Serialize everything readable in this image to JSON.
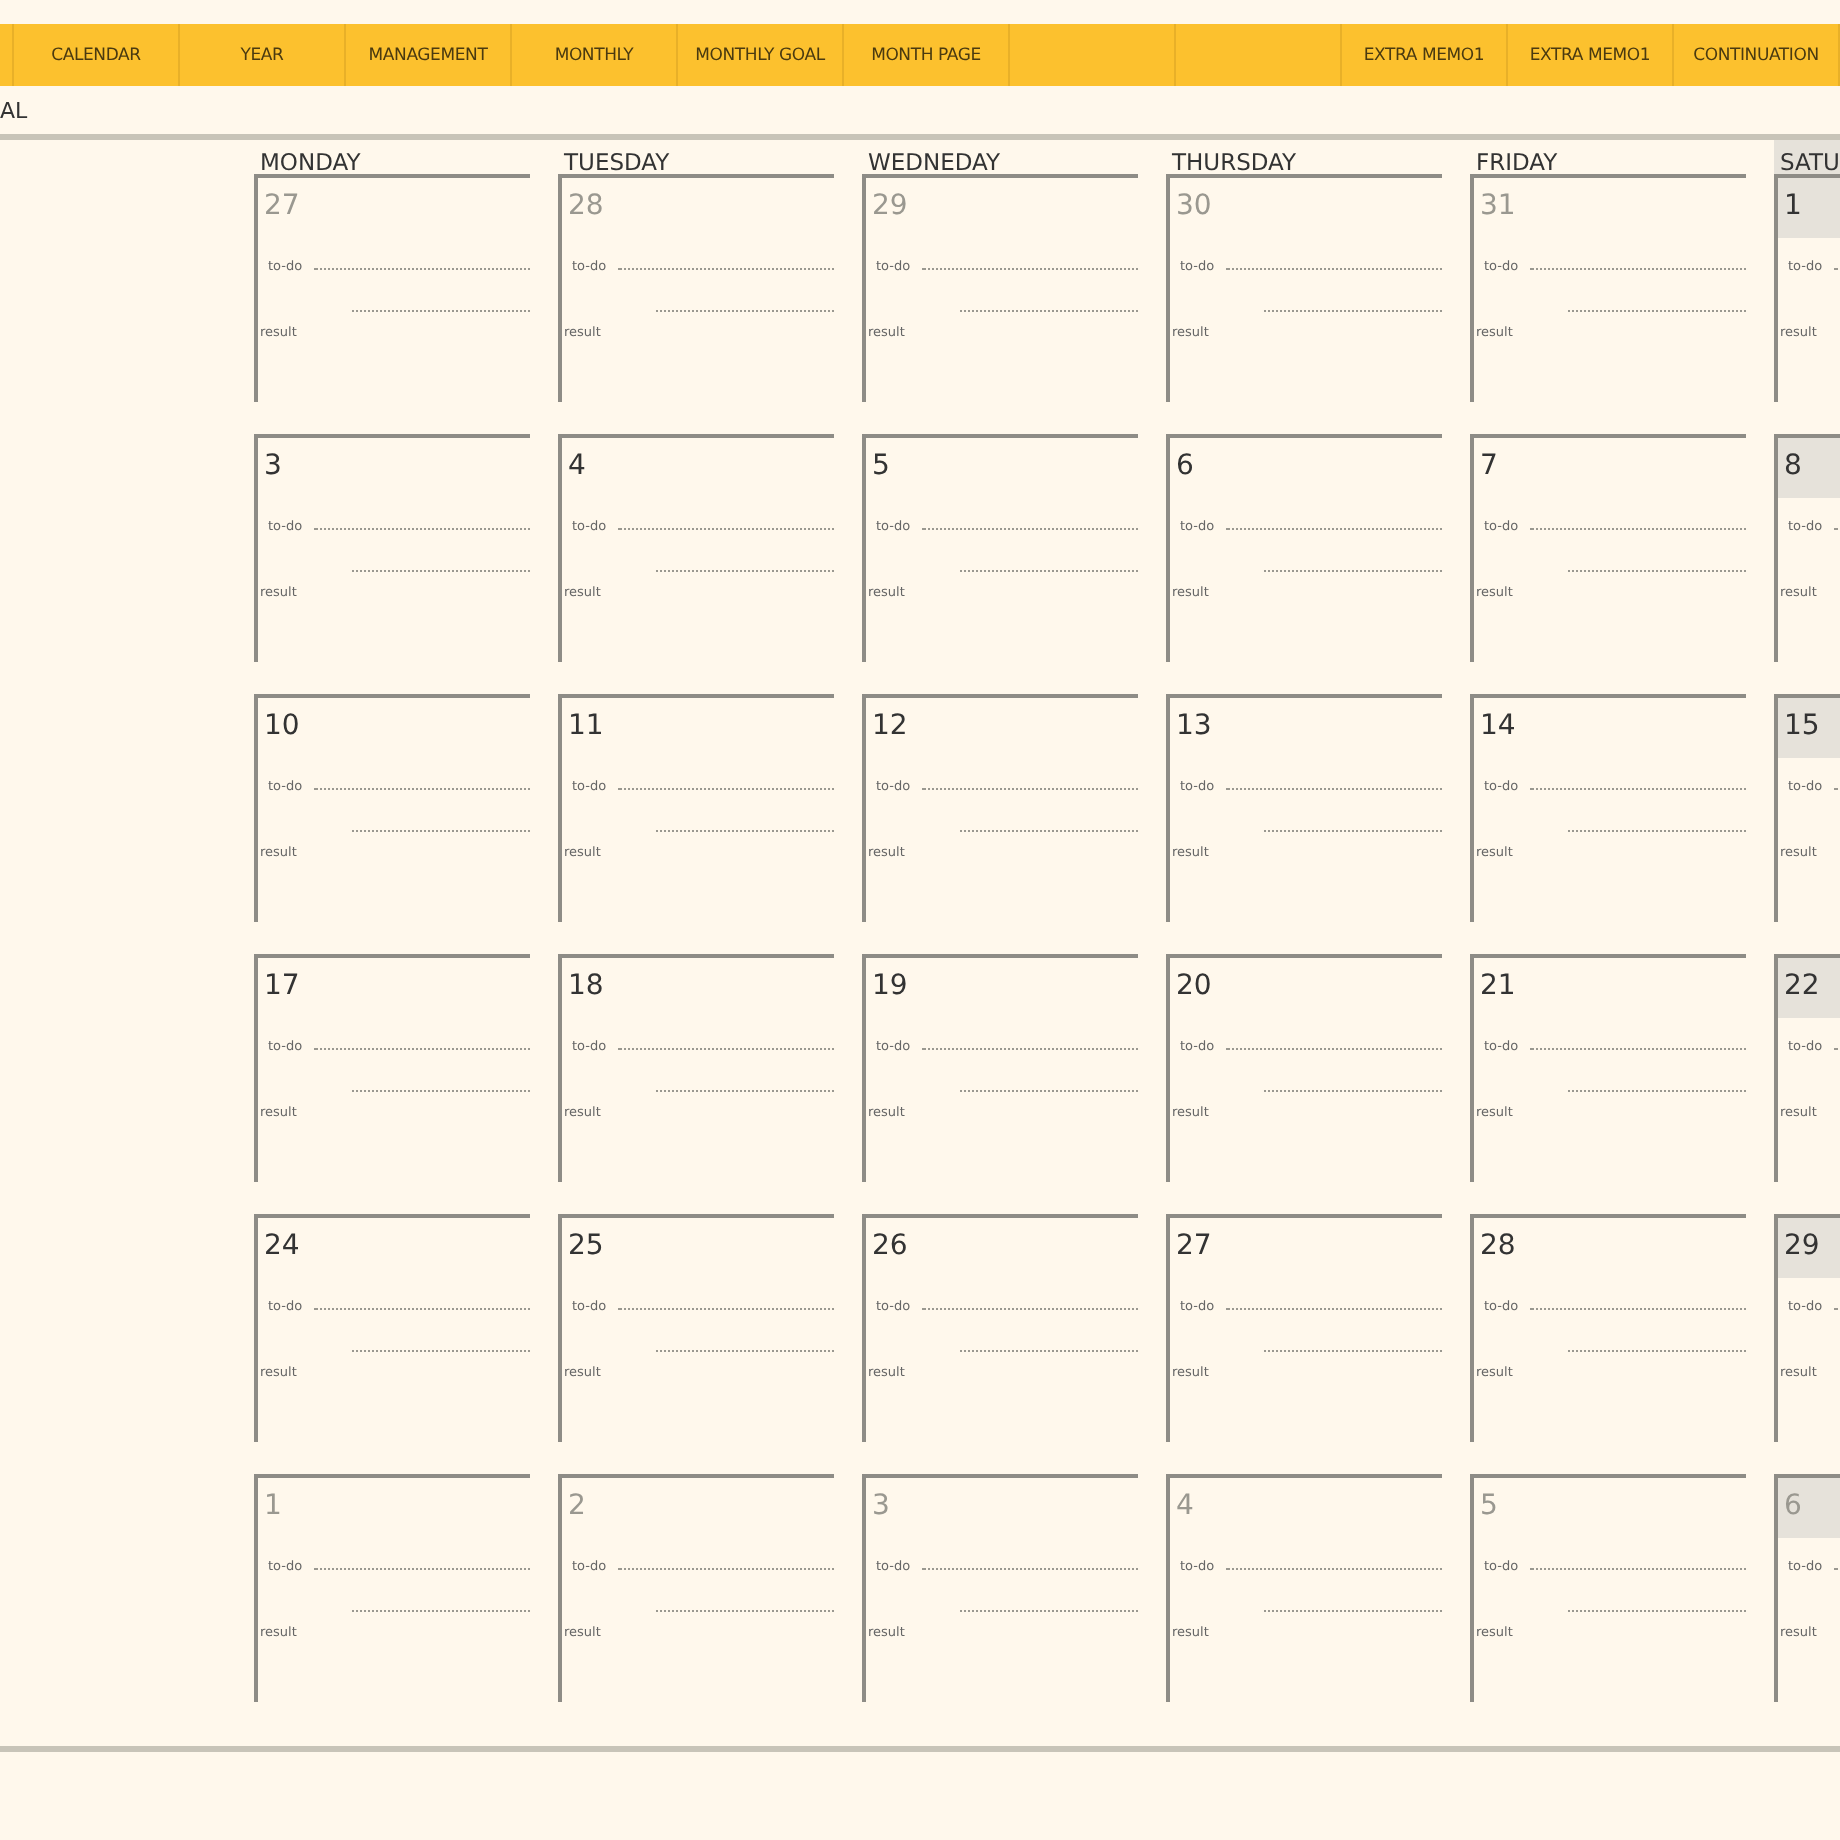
{
  "nav": [
    {
      "kind": "blank"
    },
    {
      "kind": "tab",
      "label": "CALENDAR"
    },
    {
      "kind": "tab",
      "label": "YEAR"
    },
    {
      "kind": "tab",
      "label": "MANAGEMENT"
    },
    {
      "kind": "tab",
      "label": "MONTHLY"
    },
    {
      "kind": "tab",
      "label": "MONTHLY GOAL"
    },
    {
      "kind": "tab",
      "label": "MONTH PAGE"
    },
    {
      "kind": "blank"
    },
    {
      "kind": "blank"
    },
    {
      "kind": "tab",
      "label": "EXTRA MEMO1"
    },
    {
      "kind": "tab",
      "label": "EXTRA MEMO1"
    },
    {
      "kind": "tab",
      "label": "CONTINUATION"
    }
  ],
  "sheet_title": "AL",
  "columns": [
    {
      "label": "MONDAY",
      "shaded": false
    },
    {
      "label": "TUESDAY",
      "shaded": false
    },
    {
      "label": "WEDNEDAY",
      "shaded": false
    },
    {
      "label": "THURSDAY",
      "shaded": false
    },
    {
      "label": "FRIDAY",
      "shaded": false
    },
    {
      "label": "SATU",
      "shaded": true
    }
  ],
  "weeks": [
    [
      {
        "number": "27",
        "muted": true,
        "todo": "to-do",
        "result": "result"
      },
      {
        "number": "28",
        "muted": true,
        "todo": "to-do",
        "result": "result"
      },
      {
        "number": "29",
        "muted": true,
        "todo": "to-do",
        "result": "result"
      },
      {
        "number": "30",
        "muted": true,
        "todo": "to-do",
        "result": "result"
      },
      {
        "number": "31",
        "muted": true,
        "todo": "to-do",
        "result": "result"
      },
      {
        "number": "1",
        "muted": false,
        "todo": "to-do",
        "result": "result"
      }
    ],
    [
      {
        "number": "3",
        "muted": false,
        "todo": "to-do",
        "result": "result"
      },
      {
        "number": "4",
        "muted": false,
        "todo": "to-do",
        "result": "result"
      },
      {
        "number": "5",
        "muted": false,
        "todo": "to-do",
        "result": "result"
      },
      {
        "number": "6",
        "muted": false,
        "todo": "to-do",
        "result": "result"
      },
      {
        "number": "7",
        "muted": false,
        "todo": "to-do",
        "result": "result"
      },
      {
        "number": "8",
        "muted": false,
        "todo": "to-do",
        "result": "result"
      }
    ],
    [
      {
        "number": "10",
        "muted": false,
        "todo": "to-do",
        "result": "result"
      },
      {
        "number": "11",
        "muted": false,
        "todo": "to-do",
        "result": "result"
      },
      {
        "number": "12",
        "muted": false,
        "todo": "to-do",
        "result": "result"
      },
      {
        "number": "13",
        "muted": false,
        "todo": "to-do",
        "result": "result"
      },
      {
        "number": "14",
        "muted": false,
        "todo": "to-do",
        "result": "result"
      },
      {
        "number": "15",
        "muted": false,
        "todo": "to-do",
        "result": "result"
      }
    ],
    [
      {
        "number": "17",
        "muted": false,
        "todo": "to-do",
        "result": "result"
      },
      {
        "number": "18",
        "muted": false,
        "todo": "to-do",
        "result": "result"
      },
      {
        "number": "19",
        "muted": false,
        "todo": "to-do",
        "result": "result"
      },
      {
        "number": "20",
        "muted": false,
        "todo": "to-do",
        "result": "result"
      },
      {
        "number": "21",
        "muted": false,
        "todo": "to-do",
        "result": "result"
      },
      {
        "number": "22",
        "muted": false,
        "todo": "to-do",
        "result": "result"
      }
    ],
    [
      {
        "number": "24",
        "muted": false,
        "todo": "to-do",
        "result": "result"
      },
      {
        "number": "25",
        "muted": false,
        "todo": "to-do",
        "result": "result"
      },
      {
        "number": "26",
        "muted": false,
        "todo": "to-do",
        "result": "result"
      },
      {
        "number": "27",
        "muted": false,
        "todo": "to-do",
        "result": "result"
      },
      {
        "number": "28",
        "muted": false,
        "todo": "to-do",
        "result": "result"
      },
      {
        "number": "29",
        "muted": false,
        "todo": "to-do",
        "result": "result"
      }
    ],
    [
      {
        "number": "1",
        "muted": true,
        "todo": "to-do",
        "result": "result"
      },
      {
        "number": "2",
        "muted": true,
        "todo": "to-do",
        "result": "result"
      },
      {
        "number": "3",
        "muted": true,
        "todo": "to-do",
        "result": "result"
      },
      {
        "number": "4",
        "muted": true,
        "todo": "to-do",
        "result": "result"
      },
      {
        "number": "5",
        "muted": true,
        "todo": "to-do",
        "result": "result"
      },
      {
        "number": "6",
        "muted": true,
        "todo": "to-do",
        "result": "result"
      }
    ]
  ]
}
